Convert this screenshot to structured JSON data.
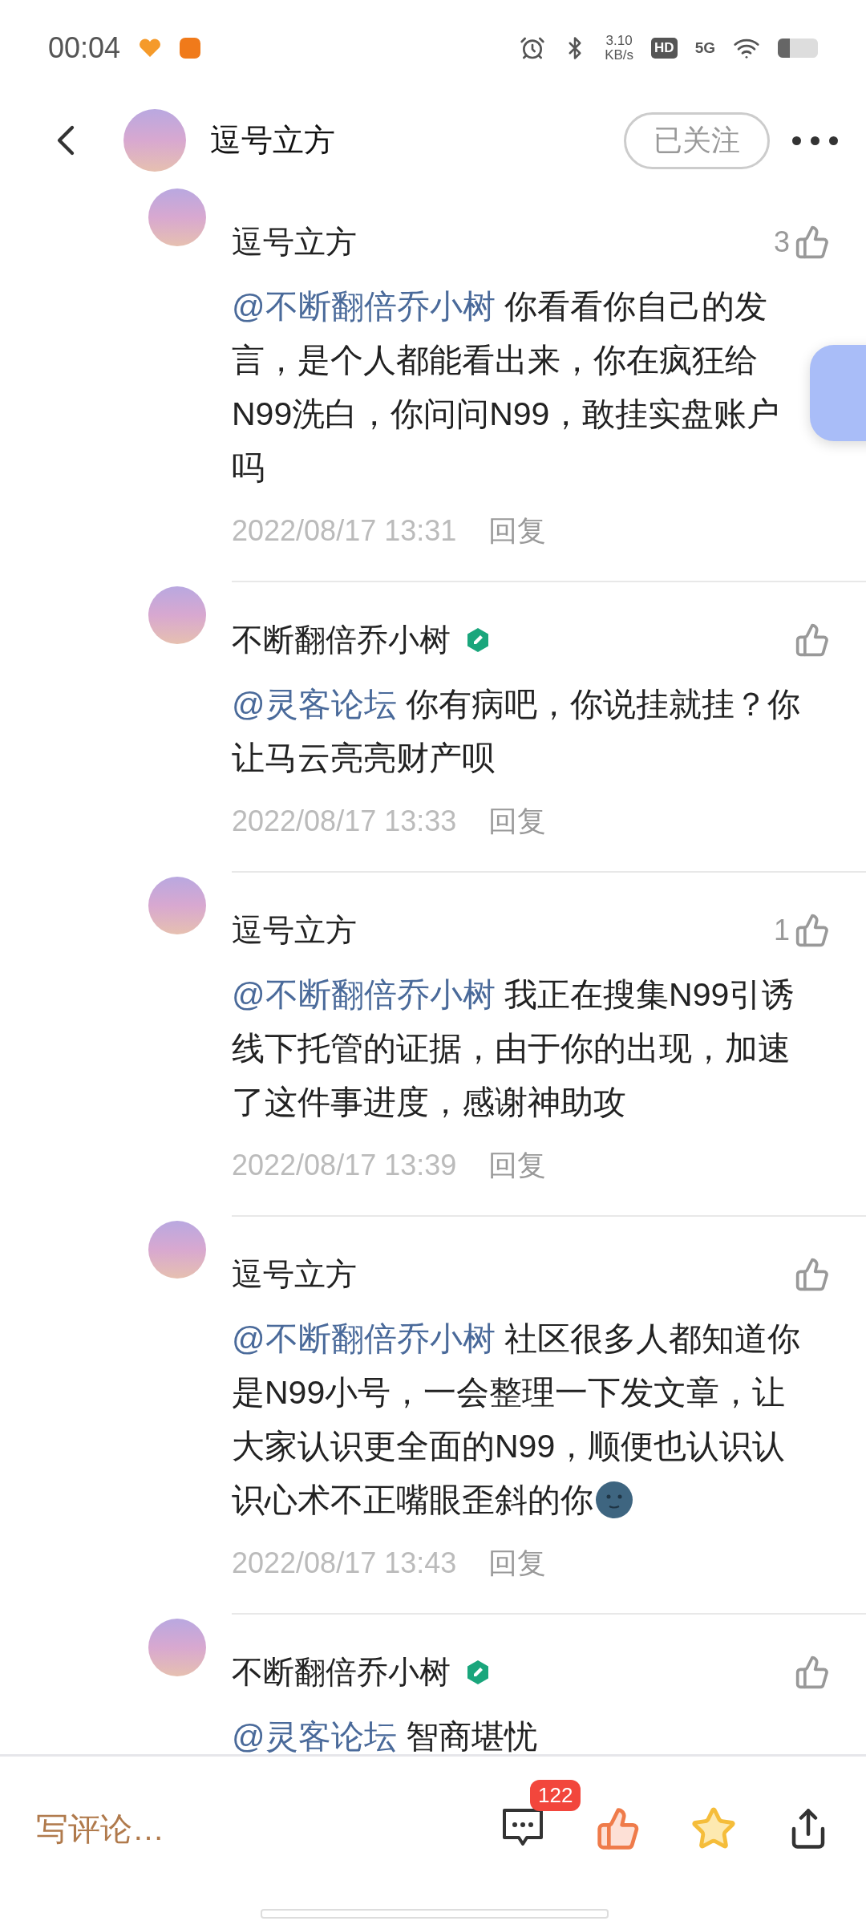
{
  "status_bar": {
    "time": "00:04",
    "net_speed": "3.10",
    "net_unit": "KB/s",
    "hd": "HD",
    "network": "5G"
  },
  "header": {
    "title": "逗号立方",
    "follow_button": "已关注"
  },
  "comments": [
    {
      "author": "逗号立方",
      "verified": false,
      "likes": "3",
      "mention": "@不断翻倍乔小树",
      "text": "你看看你自己的发言，是个人都能看出来，你在疯狂给N99洗白，你问问N99，敢挂实盘账户吗",
      "emoji": false,
      "date": "2022/08/17 13:31",
      "reply": "回复"
    },
    {
      "author": "不断翻倍乔小树",
      "verified": true,
      "mention": "@灵客论坛",
      "text": "你有病吧，你说挂就挂？你让马云亮亮财产呗",
      "emoji": false,
      "date": "2022/08/17 13:33",
      "reply": "回复"
    },
    {
      "author": "逗号立方",
      "verified": false,
      "likes": "1",
      "mention": "@不断翻倍乔小树",
      "text": "我正在搜集N99引诱线下托管的证据，由于你的出现，加速了这件事进度，感谢神助攻",
      "emoji": false,
      "date": "2022/08/17 13:39",
      "reply": "回复"
    },
    {
      "author": "逗号立方",
      "verified": false,
      "mention": "@不断翻倍乔小树",
      "text": "社区很多人都知道你是N99小号，一会整理一下发文章，让大家认识更全面的N99，顺便也认识认识心术不正嘴眼歪斜的你",
      "emoji": true,
      "date": "2022/08/17 13:43",
      "reply": "回复"
    },
    {
      "author": "不断翻倍乔小树",
      "verified": true,
      "mention": "@灵客论坛",
      "text": "智商堪忧",
      "emoji": false
    }
  ],
  "bottom_bar": {
    "placeholder": "写评论…",
    "comment_count": "122",
    "liked": true,
    "starred": true
  }
}
